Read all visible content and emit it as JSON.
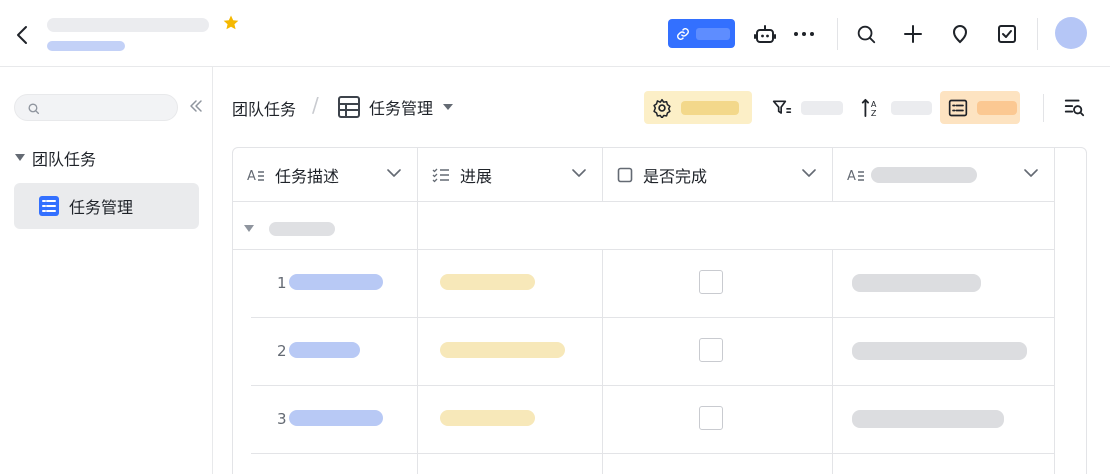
{
  "breadcrumb": {
    "workspace": "团队任务",
    "separator": "/",
    "table": "任务管理"
  },
  "sidebar": {
    "group_label": "团队任务",
    "item_label": "任务管理"
  },
  "columns": [
    {
      "label": "任务描述",
      "type_icon": "text-field-icon"
    },
    {
      "label": "进展",
      "type_icon": "checklist-field-icon"
    },
    {
      "label": "是否完成",
      "type_icon": "checkbox-field-icon"
    },
    {
      "label": "",
      "type_icon": "text-field-icon"
    }
  ],
  "rows": [
    {
      "number": "1",
      "done": false
    },
    {
      "number": "2",
      "done": false
    },
    {
      "number": "3",
      "done": false
    }
  ],
  "colors": {
    "accent": "#3370ff",
    "settings_highlight": "#fcefc7",
    "view_highlight": "#fde3c1",
    "star": "#f5b800"
  }
}
